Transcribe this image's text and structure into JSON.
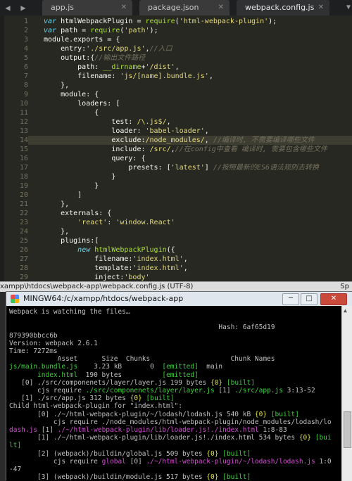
{
  "tabs": [
    {
      "label": "app.js",
      "active": false
    },
    {
      "label": "package.json",
      "active": false
    },
    {
      "label": "webpack.config.js",
      "active": true
    }
  ],
  "editor": {
    "line_numbers": [
      "1",
      "2",
      "3",
      "4",
      "5",
      "6",
      "7",
      "8",
      "9",
      "10",
      "11",
      "12",
      "13",
      "14",
      "15",
      "16",
      "17",
      "18",
      "19",
      "20",
      "21",
      "22",
      "23",
      "24",
      "25",
      "26",
      "27",
      "28",
      "29",
      "30",
      "31"
    ],
    "highlighted_line": 14,
    "lines": [
      [
        {
          "t": "k",
          "v": "var"
        },
        {
          "t": "p",
          "v": " htmlWebpackPlugin = "
        },
        {
          "t": "f",
          "v": "require"
        },
        {
          "t": "p",
          "v": "("
        },
        {
          "t": "s",
          "v": "'html-webpack-plugin'"
        },
        {
          "t": "p",
          "v": ");"
        }
      ],
      [
        {
          "t": "k",
          "v": "var"
        },
        {
          "t": "p",
          "v": " path = "
        },
        {
          "t": "f",
          "v": "require"
        },
        {
          "t": "p",
          "v": "("
        },
        {
          "t": "s",
          "v": "'path'"
        },
        {
          "t": "p",
          "v": ");"
        }
      ],
      [
        {
          "t": "p",
          "v": "module.exports = {"
        }
      ],
      [
        {
          "t": "p",
          "v": "    entry:"
        },
        {
          "t": "s",
          "v": "'./src/app.js'"
        },
        {
          "t": "p",
          "v": ","
        },
        {
          "t": "c",
          "v": "//入口"
        }
      ],
      [
        {
          "t": "p",
          "v": "    output:{"
        },
        {
          "t": "c",
          "v": "//输出文件路径"
        }
      ],
      [
        {
          "t": "p",
          "v": "        path: "
        },
        {
          "t": "f",
          "v": "__dirname"
        },
        {
          "t": "p",
          "v": "+"
        },
        {
          "t": "s",
          "v": "'/dist'"
        },
        {
          "t": "p",
          "v": ","
        }
      ],
      [
        {
          "t": "p",
          "v": "        filename: "
        },
        {
          "t": "s",
          "v": "'js/[name].bundle.js'"
        },
        {
          "t": "p",
          "v": ","
        }
      ],
      [
        {
          "t": "p",
          "v": "    },"
        }
      ],
      [
        {
          "t": "p",
          "v": "    module: {"
        }
      ],
      [
        {
          "t": "p",
          "v": "        loaders: ["
        }
      ],
      [
        {
          "t": "p",
          "v": "            {"
        }
      ],
      [
        {
          "t": "p",
          "v": "                test: "
        },
        {
          "t": "s",
          "v": "/\\.js$/"
        },
        {
          "t": "p",
          "v": ","
        }
      ],
      [
        {
          "t": "p",
          "v": "                loader: "
        },
        {
          "t": "s",
          "v": "'babel-loader'"
        },
        {
          "t": "p",
          "v": ","
        }
      ],
      [
        {
          "t": "p",
          "v": "                exclude:"
        },
        {
          "t": "s",
          "v": "/node_modules/"
        },
        {
          "t": "p",
          "v": ", "
        },
        {
          "t": "c",
          "v": "//编译时, 不需要编译哪些文件"
        }
      ],
      [
        {
          "t": "p",
          "v": "                include: "
        },
        {
          "t": "s",
          "v": "/src/"
        },
        {
          "t": "p",
          "v": ","
        },
        {
          "t": "c",
          "v": "//在config中查看 编译时, 需要包含哪些文件"
        }
      ],
      [
        {
          "t": "p",
          "v": "                query: {"
        }
      ],
      [
        {
          "t": "p",
          "v": "                    presets: ["
        },
        {
          "t": "s",
          "v": "'latest'"
        },
        {
          "t": "p",
          "v": "] "
        },
        {
          "t": "c",
          "v": "//按照最新的ES6语法规则去转换"
        }
      ],
      [
        {
          "t": "p",
          "v": "                }"
        }
      ],
      [
        {
          "t": "p",
          "v": "            }"
        }
      ],
      [
        {
          "t": "p",
          "v": "        ]"
        }
      ],
      [
        {
          "t": "p",
          "v": "    },"
        }
      ],
      [
        {
          "t": "p",
          "v": "    externals: {"
        }
      ],
      [
        {
          "t": "p",
          "v": "        "
        },
        {
          "t": "s",
          "v": "'react'"
        },
        {
          "t": "p",
          "v": ": "
        },
        {
          "t": "s",
          "v": "'window.React'"
        }
      ],
      [
        {
          "t": "p",
          "v": "    },"
        }
      ],
      [
        {
          "t": "p",
          "v": "    plugins:["
        }
      ],
      [
        {
          "t": "p",
          "v": "        "
        },
        {
          "t": "k",
          "v": "new"
        },
        {
          "t": "p",
          "v": " "
        },
        {
          "t": "f",
          "v": "htmlWebpackPlugin"
        },
        {
          "t": "p",
          "v": "({"
        }
      ],
      [
        {
          "t": "p",
          "v": "            filename:"
        },
        {
          "t": "s",
          "v": "'index.html'"
        },
        {
          "t": "p",
          "v": ","
        }
      ],
      [
        {
          "t": "p",
          "v": "            template:"
        },
        {
          "t": "s",
          "v": "'index.html'"
        },
        {
          "t": "p",
          "v": ","
        }
      ],
      [
        {
          "t": "p",
          "v": "            inject:"
        },
        {
          "t": "s",
          "v": "'body'"
        }
      ],
      [
        {
          "t": "p",
          "v": "        })"
        }
      ],
      [
        {
          "t": "p",
          "v": "    ]"
        }
      ]
    ]
  },
  "statusbar": {
    "path": "xampp\\htdocs\\webpack-app\\webpack.config.js (UTF-8)",
    "right": "Sp"
  },
  "terminal": {
    "title": "MINGW64:/c/xampp/htdocs/webpack-app",
    "buttons": {
      "minimize": "─",
      "maximize": "□",
      "close": "✕"
    },
    "lines": [
      [
        {
          "t": "p",
          "v": "Webpack is watching the files…"
        }
      ],
      [
        {
          "t": "p",
          "v": ""
        }
      ],
      [
        {
          "t": "p",
          "v": "                                                    Hash: 6af65d19"
        }
      ],
      [
        {
          "t": "p",
          "v": "879390bbcc6b"
        }
      ],
      [
        {
          "t": "p",
          "v": "Version: webpack 2.6.1"
        }
      ],
      [
        {
          "t": "p",
          "v": "Time: 7272ms"
        }
      ],
      [
        {
          "t": "p",
          "v": "            Asset      Size  Chunks                    Chunk Names"
        }
      ],
      [
        {
          "t": "g",
          "v": "js/main.bundle.js"
        },
        {
          "t": "p",
          "v": "    3.23 kB       0  "
        },
        {
          "t": "g",
          "v": "[emitted]"
        },
        {
          "t": "p",
          "v": "  main"
        }
      ],
      [
        {
          "t": "g",
          "v": "       index.html"
        },
        {
          "t": "p",
          "v": "  190 bytes          "
        },
        {
          "t": "g",
          "v": "[emitted]"
        }
      ],
      [
        {
          "t": "p",
          "v": "   [0] ./src/componenets/layer/layer.js 199 bytes "
        },
        {
          "t": "y",
          "v": "{0}"
        },
        {
          "t": "p",
          "v": " "
        },
        {
          "t": "g",
          "v": "[built]"
        }
      ],
      [
        {
          "t": "p",
          "v": "       cjs require "
        },
        {
          "t": "g",
          "v": "./src/componenets/layer/layer.js"
        },
        {
          "t": "p",
          "v": " [1] "
        },
        {
          "t": "g",
          "v": "./src/app.js"
        },
        {
          "t": "p",
          "v": " 3:13-52"
        }
      ],
      [
        {
          "t": "p",
          "v": "   [1] ./src/app.js 312 bytes "
        },
        {
          "t": "y",
          "v": "{0}"
        },
        {
          "t": "p",
          "v": " "
        },
        {
          "t": "g",
          "v": "[built]"
        }
      ],
      [
        {
          "t": "p",
          "v": "Child html-webpack-plugin for \"index.html\":"
        }
      ],
      [
        {
          "t": "p",
          "v": "       [0] ./~/html-webpack-plugin/~/lodash/lodash.js 540 kB "
        },
        {
          "t": "y",
          "v": "{0}"
        },
        {
          "t": "p",
          "v": " "
        },
        {
          "t": "g",
          "v": "[built]"
        }
      ],
      [
        {
          "t": "p",
          "v": "           cjs require ./node_modules/html-webpack-plugin/node_modules/lodash/lo"
        }
      ],
      [
        {
          "t": "m",
          "v": "dash.js"
        },
        {
          "t": "p",
          "v": " [1] "
        },
        {
          "t": "m",
          "v": "./~/html-webpack-plugin/lib/loader.js!./index.html"
        },
        {
          "t": "p",
          "v": " 1:8-83"
        }
      ],
      [
        {
          "t": "p",
          "v": "       [1] ./~/html-webpack-plugin/lib/loader.js!./index.html 534 bytes "
        },
        {
          "t": "y",
          "v": "{0}"
        },
        {
          "t": "p",
          "v": " "
        },
        {
          "t": "g",
          "v": "[bui"
        }
      ],
      [
        {
          "t": "g",
          "v": "lt]"
        }
      ],
      [
        {
          "t": "p",
          "v": "       [2] (webpack)/buildin/global.js 509 bytes "
        },
        {
          "t": "y",
          "v": "{0}"
        },
        {
          "t": "p",
          "v": " "
        },
        {
          "t": "g",
          "v": "[built]"
        }
      ],
      [
        {
          "t": "p",
          "v": "           cjs require "
        },
        {
          "t": "m",
          "v": "global"
        },
        {
          "t": "p",
          "v": " [0] "
        },
        {
          "t": "m",
          "v": "./~/html-webpack-plugin/~/lodash/lodash.js"
        },
        {
          "t": "p",
          "v": " 1:0"
        }
      ],
      [
        {
          "t": "p",
          "v": "-47"
        }
      ],
      [
        {
          "t": "p",
          "v": "       [3] (webpack)/buildin/module.js 517 bytes "
        },
        {
          "t": "y",
          "v": "{0}"
        },
        {
          "t": "p",
          "v": " "
        },
        {
          "t": "g",
          "v": "[built]"
        }
      ],
      [
        {
          "t": "p",
          "v": "           cjs require "
        },
        {
          "t": "m",
          "v": "module"
        },
        {
          "t": "p",
          "v": " [0] "
        },
        {
          "t": "m",
          "v": "./~/html-webpack-plugin/~/lodash/lodash.js"
        },
        {
          "t": "p",
          "v": " 1:0"
        }
      ],
      [
        {
          "t": "p",
          "v": "-47"
        }
      ]
    ]
  },
  "colors": {
    "editor_bg": "#272822",
    "keyword": "#66d9ef",
    "string": "#e6db74",
    "comment": "#75715e",
    "function": "#a6e22e",
    "terminal_green": "#3fcf3f",
    "terminal_yellow": "#e0e040",
    "terminal_magenta": "#d34cd3"
  }
}
